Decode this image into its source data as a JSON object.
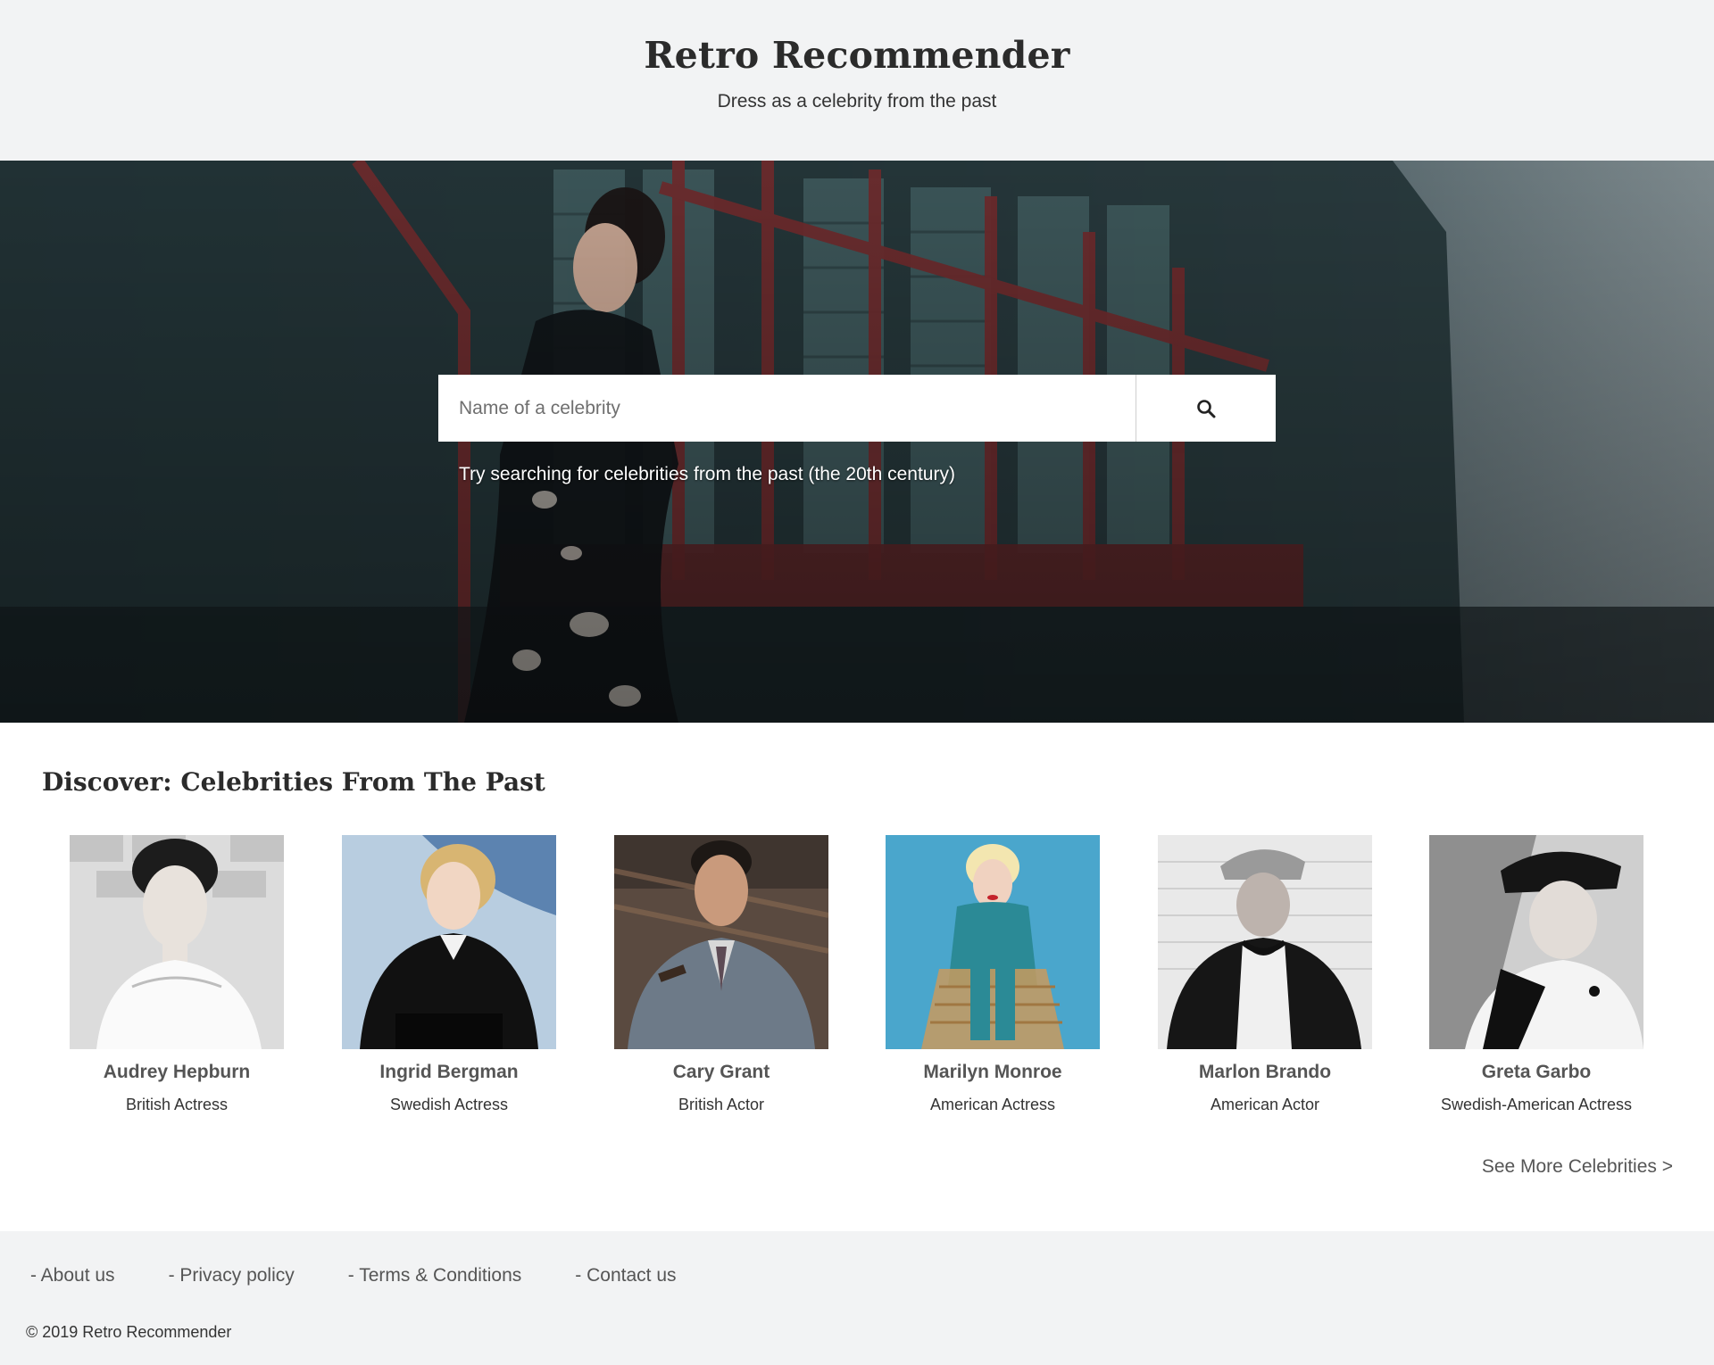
{
  "header": {
    "title": "Retro Recommender",
    "tagline": "Dress as a celebrity from the past"
  },
  "hero": {
    "search": {
      "placeholder": "Name of a celebrity",
      "value": "",
      "button_icon": "search-icon"
    },
    "hint": "Try searching for celebrities from the past (the 20th century)"
  },
  "discover": {
    "title": "Discover: Celebrities From The Past",
    "celebrities": [
      {
        "name": "Audrey Hepburn",
        "description": "British Actress"
      },
      {
        "name": "Ingrid Bergman",
        "description": "Swedish Actress"
      },
      {
        "name": "Cary Grant",
        "description": "British Actor"
      },
      {
        "name": "Marilyn Monroe",
        "description": "American Actress"
      },
      {
        "name": "Marlon Brando",
        "description": "American Actor"
      },
      {
        "name": "Greta Garbo",
        "description": "Swedish-American Actress"
      }
    ],
    "see_more": "See More Celebrities >"
  },
  "footer": {
    "links": [
      "- About us",
      "- Privacy policy",
      "- Terms & Conditions",
      "- Contact us"
    ],
    "copyright": "© 2019 Retro Recommender"
  },
  "colors": {
    "header_bg": "#f2f3f4",
    "footer_bg": "#f2f3f4",
    "title_text": "#2b2b2b",
    "muted_text": "#555555"
  }
}
